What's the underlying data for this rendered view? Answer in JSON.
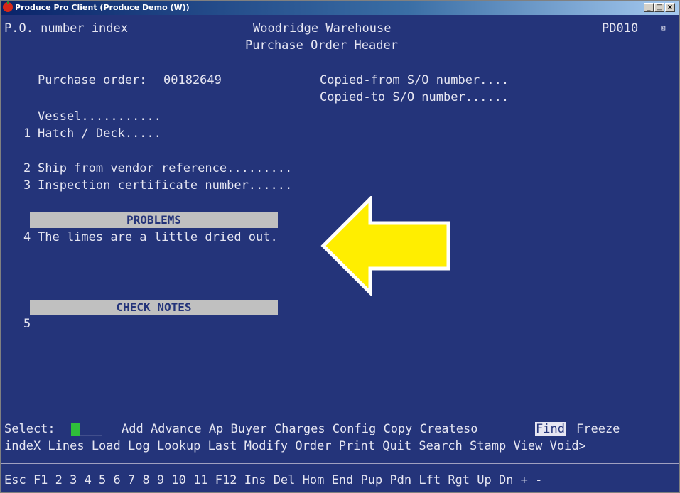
{
  "window": {
    "title": "Produce Pro Client (Produce Demo (W))",
    "buttons": [
      "_",
      "□",
      "×"
    ]
  },
  "screen": {
    "mode": "P.O. number index",
    "warehouse": "Woodridge Warehouse",
    "screen_code": "PD010",
    "subtitle": "Purchase Order Header",
    "po_label": "Purchase order:",
    "po_number": "00182649",
    "copied_from": "Copied-from S/O number....",
    "copied_to": "Copied-to S/O number......",
    "vessel": "Vessel...........",
    "hatch_num": "1",
    "hatch": "Hatch / Deck.....",
    "ship_num": "2",
    "ship_ref": "Ship from vendor reference.........",
    "insp_num": "3",
    "insp_cert": "Inspection certificate number......",
    "problems_header": "PROBLEMS",
    "problem_num": "4",
    "problem_text": "The limes are a little dried out.",
    "check_header": "CHECK NOTES",
    "check_num": "5"
  },
  "command_line": {
    "select_label": "Select:",
    "select_blanks": "___",
    "row1_a": "Add Advance Ap Buyer Charges Config Copy Createso",
    "row1_highlight": "Find",
    "row1_b": "Freeze",
    "row2": "indeX Lines Load Log Lookup Last Modify Order Print Quit Search Stamp View Void>"
  },
  "function_keys": "Esc F1 2 3 4 5 6 7 8 9 10 11 F12 Ins Del Hom End Pup Pdn Lft Rgt Up Dn + -",
  "colors": {
    "background": "#24347a",
    "text": "#e6e6f2",
    "header_bar": "#c0c0c0",
    "arrow": "#ffee00",
    "cursor": "#2fbf3a"
  }
}
